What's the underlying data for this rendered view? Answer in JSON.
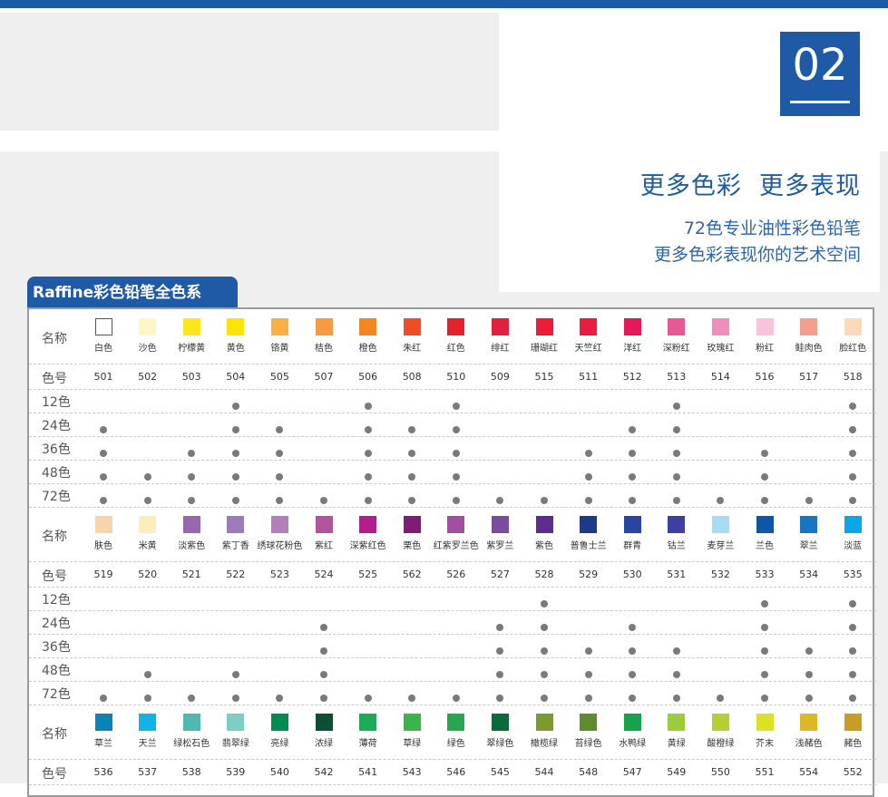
{
  "header": {
    "page_number": "02"
  },
  "headline": {
    "slogan": "更多色彩  更多表现",
    "line1": "72色专业油性彩色铅笔",
    "line2": "更多色彩表现你的艺术空间"
  },
  "table": {
    "title": "Raffine彩色铅笔全色系",
    "labels": {
      "name": "名称",
      "code": "色号"
    },
    "sets": [
      "12色",
      "24色",
      "36色",
      "48色",
      "72色"
    ],
    "blocks": [
      {
        "colors": [
          {
            "name": "白色",
            "code": "501",
            "hex": "#ffffff",
            "sets": [
              0,
              1,
              1,
              1,
              1
            ]
          },
          {
            "name": "沙色",
            "code": "502",
            "hex": "#fdf7c6",
            "sets": [
              0,
              0,
              0,
              1,
              1
            ]
          },
          {
            "name": "柠檬黄",
            "code": "503",
            "hex": "#fde71b",
            "sets": [
              0,
              0,
              1,
              1,
              1
            ]
          },
          {
            "name": "黄色",
            "code": "504",
            "hex": "#fbe408",
            "sets": [
              1,
              1,
              1,
              1,
              1
            ]
          },
          {
            "name": "铬黄",
            "code": "505",
            "hex": "#fbb042",
            "sets": [
              0,
              1,
              1,
              1,
              1
            ]
          },
          {
            "name": "桔色",
            "code": "507",
            "hex": "#f89a44",
            "sets": [
              0,
              0,
              0,
              0,
              1
            ]
          },
          {
            "name": "橙色",
            "code": "506",
            "hex": "#f68621",
            "sets": [
              1,
              1,
              1,
              1,
              1
            ]
          },
          {
            "name": "朱红",
            "code": "508",
            "hex": "#ef4d26",
            "sets": [
              0,
              1,
              1,
              1,
              1
            ]
          },
          {
            "name": "红色",
            "code": "510",
            "hex": "#e5222b",
            "sets": [
              1,
              1,
              1,
              1,
              1
            ]
          },
          {
            "name": "绯红",
            "code": "509",
            "hex": "#e0203c",
            "sets": [
              0,
              0,
              0,
              0,
              1
            ]
          },
          {
            "name": "珊瑚红",
            "code": "515",
            "hex": "#ea1f37",
            "sets": [
              0,
              0,
              0,
              0,
              1
            ]
          },
          {
            "name": "天竺红",
            "code": "511",
            "hex": "#ea1c3f",
            "sets": [
              0,
              0,
              1,
              1,
              1
            ]
          },
          {
            "name": "洋红",
            "code": "512",
            "hex": "#e4195a",
            "sets": [
              0,
              1,
              1,
              1,
              1
            ]
          },
          {
            "name": "深粉红",
            "code": "513",
            "hex": "#e85895",
            "sets": [
              1,
              1,
              1,
              1,
              1
            ]
          },
          {
            "name": "玫瑰红",
            "code": "514",
            "hex": "#f18dbb",
            "sets": [
              0,
              0,
              0,
              0,
              1
            ]
          },
          {
            "name": "粉红",
            "code": "516",
            "hex": "#f7c4dc",
            "sets": [
              0,
              0,
              1,
              1,
              1
            ]
          },
          {
            "name": "鲑肉色",
            "code": "517",
            "hex": "#f49e8c",
            "sets": [
              0,
              0,
              0,
              0,
              1
            ]
          },
          {
            "name": "脸红色",
            "code": "518",
            "hex": "#fcd9b8",
            "sets": [
              1,
              1,
              1,
              1,
              1
            ]
          }
        ]
      },
      {
        "colors": [
          {
            "name": "肤色",
            "code": "519",
            "hex": "#fad3a9",
            "sets": [
              0,
              0,
              0,
              0,
              1
            ]
          },
          {
            "name": "米黄",
            "code": "520",
            "hex": "#fdedbb",
            "sets": [
              0,
              0,
              0,
              1,
              1
            ]
          },
          {
            "name": "淡紫色",
            "code": "521",
            "hex": "#9868ae",
            "sets": [
              0,
              0,
              0,
              0,
              1
            ]
          },
          {
            "name": "紫丁香",
            "code": "522",
            "hex": "#9b7cb8",
            "sets": [
              0,
              0,
              0,
              1,
              1
            ]
          },
          {
            "name": "绣球花粉色",
            "code": "523",
            "hex": "#b580b9",
            "sets": [
              0,
              0,
              0,
              0,
              1
            ]
          },
          {
            "name": "紫红",
            "code": "524",
            "hex": "#b1549c",
            "sets": [
              0,
              1,
              1,
              1,
              1
            ]
          },
          {
            "name": "深紫红色",
            "code": "525",
            "hex": "#b01f8a",
            "sets": [
              0,
              0,
              0,
              0,
              1
            ]
          },
          {
            "name": "栗色",
            "code": "562",
            "hex": "#7e1d71",
            "sets": [
              0,
              0,
              0,
              0,
              1
            ]
          },
          {
            "name": "红紫罗兰色",
            "code": "526",
            "hex": "#a34fa1",
            "sets": [
              0,
              0,
              0,
              0,
              1
            ]
          },
          {
            "name": "紫罗兰",
            "code": "527",
            "hex": "#7a4c9f",
            "sets": [
              0,
              1,
              1,
              1,
              1
            ]
          },
          {
            "name": "紫色",
            "code": "528",
            "hex": "#5b2d8e",
            "sets": [
              1,
              1,
              1,
              1,
              1
            ]
          },
          {
            "name": "普鲁士兰",
            "code": "529",
            "hex": "#1c3a87",
            "sets": [
              0,
              0,
              1,
              1,
              1
            ]
          },
          {
            "name": "群青",
            "code": "530",
            "hex": "#2845a1",
            "sets": [
              0,
              1,
              1,
              1,
              1
            ]
          },
          {
            "name": "钴兰",
            "code": "531",
            "hex": "#3e3f9e",
            "sets": [
              0,
              0,
              1,
              1,
              1
            ]
          },
          {
            "name": "麦芽兰",
            "code": "532",
            "hex": "#a7dcf3",
            "sets": [
              0,
              0,
              0,
              0,
              1
            ]
          },
          {
            "name": "兰色",
            "code": "533",
            "hex": "#1056a7",
            "sets": [
              1,
              1,
              1,
              1,
              1
            ]
          },
          {
            "name": "翠兰",
            "code": "534",
            "hex": "#1976be",
            "sets": [
              0,
              0,
              1,
              1,
              1
            ]
          },
          {
            "name": "淡蓝",
            "code": "535",
            "hex": "#0aa7e6",
            "sets": [
              1,
              1,
              1,
              1,
              1
            ]
          }
        ]
      },
      {
        "colors": [
          {
            "name": "草兰",
            "code": "536",
            "hex": "#0a84b8",
            "sets": []
          },
          {
            "name": "天兰",
            "code": "537",
            "hex": "#12b4e6",
            "sets": []
          },
          {
            "name": "绿松石色",
            "code": "538",
            "hex": "#4fb9b0",
            "sets": []
          },
          {
            "name": "翡翠绿",
            "code": "539",
            "hex": "#7ccdc2",
            "sets": []
          },
          {
            "name": "亮绿",
            "code": "540",
            "hex": "#008a54",
            "sets": []
          },
          {
            "name": "浓绿",
            "code": "542",
            "hex": "#0c4f32",
            "sets": []
          },
          {
            "name": "薄荷",
            "code": "541",
            "hex": "#1daa5a",
            "sets": []
          },
          {
            "name": "草绿",
            "code": "543",
            "hex": "#3bb54a",
            "sets": []
          },
          {
            "name": "绿色",
            "code": "546",
            "hex": "#26a851",
            "sets": []
          },
          {
            "name": "翠绿色",
            "code": "545",
            "hex": "#0b6a3a",
            "sets": []
          },
          {
            "name": "橄榄绿",
            "code": "544",
            "hex": "#7d9a2f",
            "sets": []
          },
          {
            "name": "苔绿色",
            "code": "548",
            "hex": "#5f8b2a",
            "sets": []
          },
          {
            "name": "水鸭绿",
            "code": "547",
            "hex": "#17a24b",
            "sets": []
          },
          {
            "name": "黄绿",
            "code": "549",
            "hex": "#9ccc3c",
            "sets": []
          },
          {
            "name": "酸橙绿",
            "code": "550",
            "hex": "#b4cf34",
            "sets": []
          },
          {
            "name": "芥末",
            "code": "551",
            "hex": "#dbe226",
            "sets": []
          },
          {
            "name": "浅赭色",
            "code": "554",
            "hex": "#dcb826",
            "sets": []
          },
          {
            "name": "赭色",
            "code": "552",
            "hex": "#c99c24",
            "sets": []
          }
        ]
      }
    ]
  }
}
